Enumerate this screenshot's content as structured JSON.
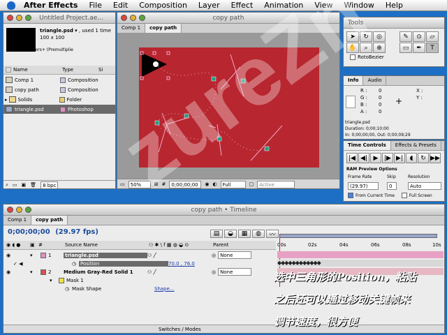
{
  "menubar": {
    "app": "After Effects",
    "items": [
      "File",
      "Edit",
      "Composition",
      "Layer",
      "Effect",
      "Animation",
      "View",
      "Window",
      "Help"
    ]
  },
  "project": {
    "title": "Untitled Project.ae...",
    "info_name": "triangle.psd",
    "info_used": ", used 1 time",
    "info_size": "100 x 100",
    "info_colors": "Millions of Colors+ (Premultiplie",
    "col_name": "Name",
    "col_type": "Type",
    "col_size": "Si",
    "items": [
      {
        "name": "Comp 1",
        "type": "Composition",
        "color": "#c8c8e0"
      },
      {
        "name": "copy path",
        "type": "Composition",
        "color": "#c8c8e0"
      },
      {
        "name": "Solids",
        "type": "Folder",
        "color": "#e8d070"
      },
      {
        "name": "triangle.psd",
        "type": "Photoshop",
        "color": "#e090c0"
      }
    ],
    "bpc": "8 bpc"
  },
  "comp": {
    "title": "copy path",
    "tabs": [
      "Comp 1",
      "copy path"
    ],
    "zoom": "50%",
    "timecode": "0;00;00;00",
    "resolution": "Full",
    "camera": "Active Camera",
    "bg_color": "#b8262f"
  },
  "tools": {
    "title": "Tools",
    "rotobezier": "RotoBezier"
  },
  "info": {
    "tabs": [
      "Info",
      "Audio"
    ],
    "rgba": [
      "R :",
      "G :",
      "B :",
      "A :"
    ],
    "xy": [
      "X :",
      "Y :"
    ],
    "vals": [
      "0",
      "0",
      "0",
      "0"
    ],
    "line1": "triangle.psd",
    "line2": "Duration: 0;00;10;00",
    "line3": "In: 0;00;00;00, Out: 0;00;09;29"
  },
  "time_controls": {
    "tabs": [
      "Time Controls",
      "Effects & Presets"
    ],
    "ram": "RAM Preview Options",
    "frame_rate_label": "Frame Rate",
    "frame_rate": "(29.97)",
    "skip_label": "Skip",
    "skip": "0",
    "res_label": "Resolution",
    "res": "Auto",
    "from_current": "From Current Time",
    "full_screen": "Full Screen"
  },
  "timeline": {
    "title": "copy path • Timeline",
    "tabs": [
      "Comp 1",
      "copy path"
    ],
    "timecode": "0;00;00;00",
    "fps": "(29.97 fps)",
    "col_source": "Source Name",
    "col_parent": "Parent",
    "ruler": [
      "00s",
      "02s",
      "04s",
      "06s",
      "08s",
      "10s"
    ],
    "layers": [
      {
        "num": "1",
        "name": "triangle.psd",
        "parent": "None"
      },
      {
        "num": "2",
        "name": "Medium Gray-Red Solid 1",
        "parent": "None"
      }
    ],
    "position_label": "Position",
    "position_value": "70.0 , 76.0",
    "mask1": "Mask 1",
    "mask_shape": "Mask Shape",
    "shape_link": "Shape...",
    "footer": "Switches / Modes"
  },
  "caption": [
    "选中三角形的Position，粘贴",
    "之后还可以通过移动关键帧来",
    "调节速度，很方便"
  ],
  "watermark": "zureZn"
}
